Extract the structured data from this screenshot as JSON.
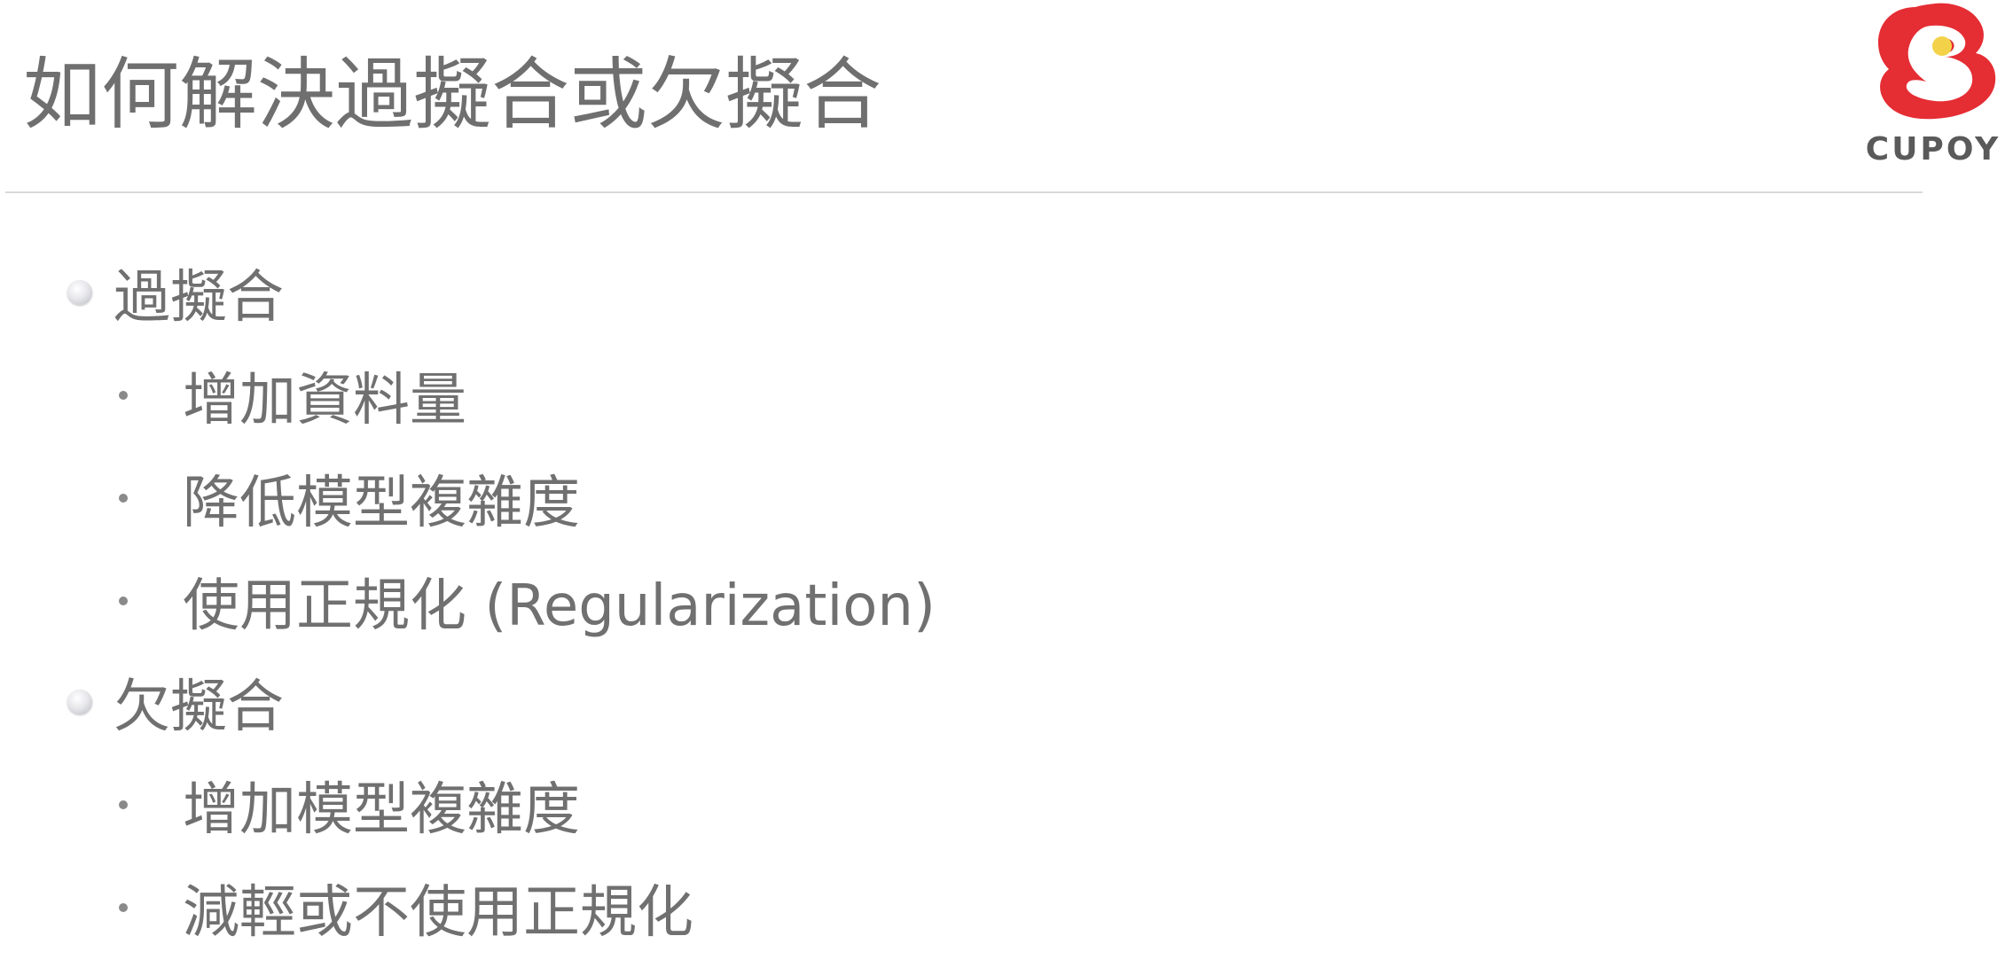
{
  "slide": {
    "title": "如何解決過擬合或欠擬合",
    "logo": {
      "text": "CUPOY",
      "brand_color": "#e52d34",
      "dot_color": "#f3d24a"
    },
    "sections": [
      {
        "heading": "過擬合",
        "items": [
          "增加資料量",
          "降低模型複雜度",
          "使用正規化 (Regularization)"
        ]
      },
      {
        "heading": "欠擬合",
        "items": [
          "增加模型複雜度",
          "減輕或不使用正規化"
        ]
      }
    ]
  }
}
